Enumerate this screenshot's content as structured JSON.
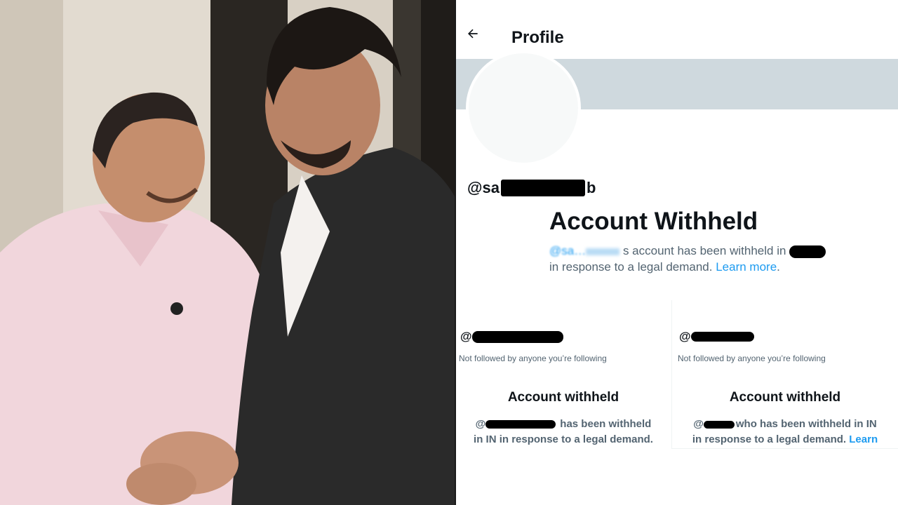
{
  "header": {
    "title": "Profile",
    "back_icon": "arrow-left-icon"
  },
  "profile": {
    "handle_prefix": "@sa",
    "handle_suffix": "b"
  },
  "withheld": {
    "title": "Account Withheld",
    "blurred_handle": "@sa…",
    "body_part1": "s account has been withheld in",
    "body_part2": "in response to a legal demand. ",
    "learn_more": "Learn more",
    "period": "."
  },
  "cards": [
    {
      "handle_prefix": "@",
      "sub": "Not followed by anyone you’re following",
      "title": "Account withheld",
      "body_prefix": "@",
      "body_line1": "has been withheld",
      "body_line2": "in IN in response to a legal demand."
    },
    {
      "handle_prefix": "@",
      "sub": "Not followed by anyone you’re following",
      "title": "Account withheld",
      "body_prefix": "@",
      "body_line1": "who has been withheld in IN",
      "body_line2": "in response to a legal demand. ",
      "learn": "Learn"
    }
  ],
  "colors": {
    "banner": "#cfd9de",
    "text": "#0f1419",
    "secondary": "#536471",
    "link": "#1d9bf0"
  }
}
